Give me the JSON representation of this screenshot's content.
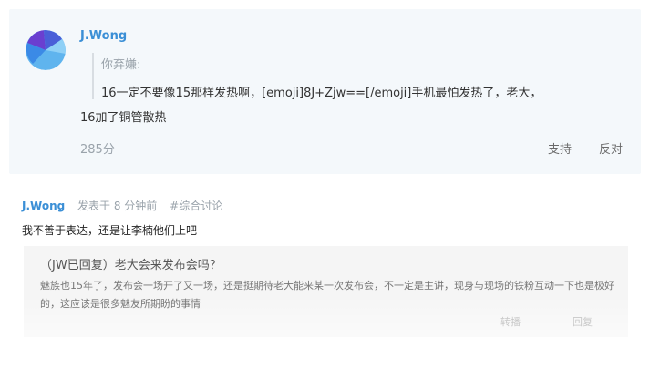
{
  "comment1": {
    "username": "J.Wong",
    "quote_label": "你弃嫌:",
    "quote_text": "16一定不要像15那样发热啊，[emoji]8J+Zjw==[/emoji]手机最怕发热了，老大，",
    "quote_text_cont": "16加了铜管散热",
    "score": "285分",
    "support_label": "支持",
    "oppose_label": "反对"
  },
  "comment2": {
    "username": "J.Wong",
    "time": "发表于 8 分钟前",
    "topic": "#综合讨论",
    "text": "我不善于表达，还是让李楠他们上吧",
    "reply": {
      "title": "（JW已回复）老大会来发布会吗？",
      "text": "魅族也15年了，发布会一场开了又一场，还是挺期待老大能来某一次发布会，不一定是主讲，现身与现场的铁粉互动一下也是极好的，这应该是很多魅友所期盼的事情",
      "forward_label": "转播",
      "reply_label": "回复"
    }
  },
  "colors": {
    "accent": "#3b8fd6",
    "card_bg": "#f4f8fb"
  }
}
